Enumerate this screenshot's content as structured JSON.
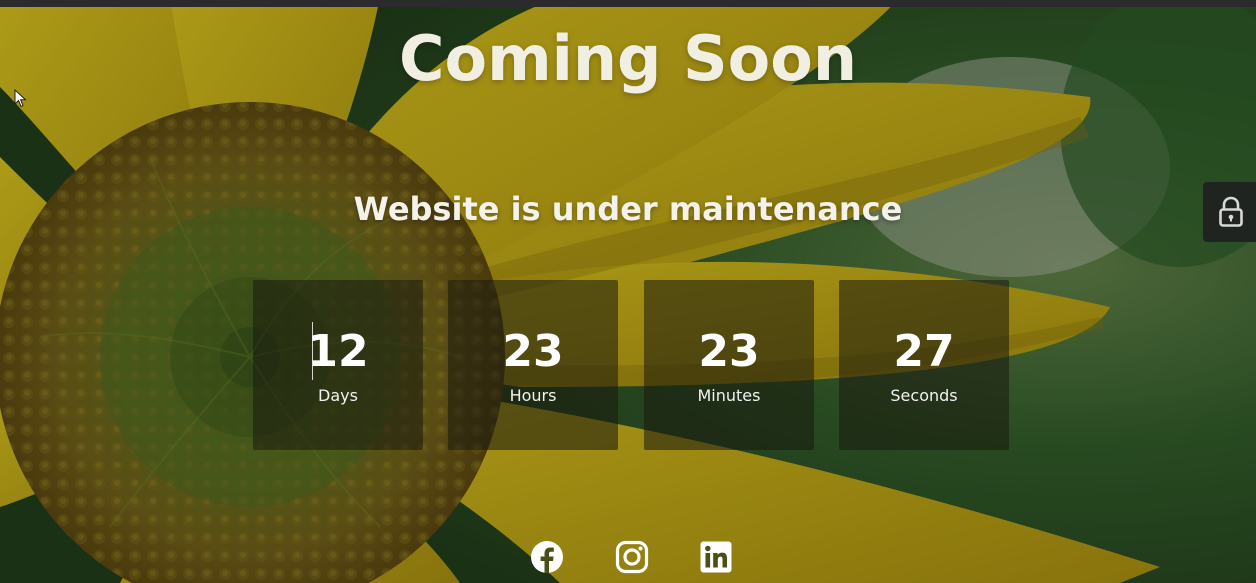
{
  "page": {
    "title": "Coming Soon",
    "subtitle": "Website is under maintenance"
  },
  "countdown": {
    "items": [
      {
        "value": "12",
        "label": "Days"
      },
      {
        "value": "23",
        "label": "Hours"
      },
      {
        "value": "23",
        "label": "Minutes"
      },
      {
        "value": "27",
        "label": "Seconds"
      }
    ]
  },
  "social": {
    "links": [
      {
        "icon": "facebook-icon"
      },
      {
        "icon": "instagram-icon"
      },
      {
        "icon": "linkedin-icon"
      }
    ]
  },
  "side_button": {
    "icon": "lock-icon"
  },
  "colors": {
    "text": "#f1eee2",
    "box_bg": "rgba(25,25,15,0.55)",
    "petal": "#c9b21a",
    "foliage": "#2f5a2a"
  }
}
